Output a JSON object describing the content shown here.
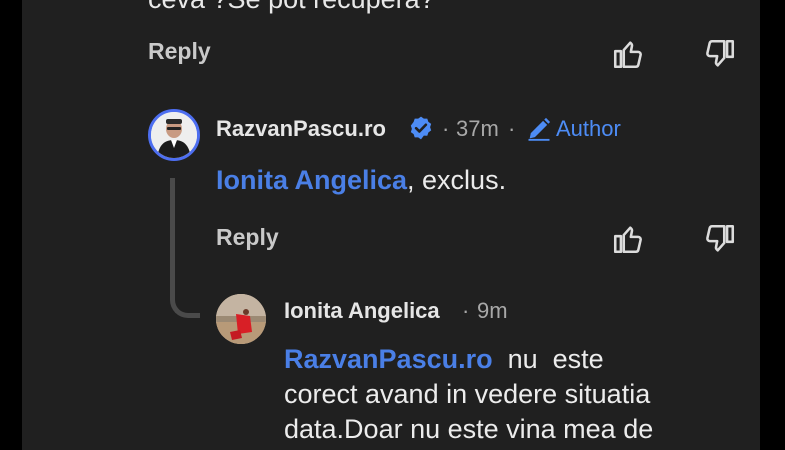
{
  "previous_comment": {
    "text_fragment": "ceva ?Se pot recupera?",
    "reply_label": "Reply"
  },
  "comment_author": {
    "name": "RazvanPascu.ro",
    "time": "37m",
    "separator": "·",
    "author_badge": "Author",
    "mention": "Ionita Angelica",
    "text": ", exclus.",
    "reply_label": "Reply"
  },
  "comment_reply": {
    "name": "Ionita Angelica",
    "time": "9m",
    "separator": "·",
    "mention": "RazvanPascu.ro",
    "lines": [
      "  nu  este",
      "corect avand in vedere situatia",
      "data.Doar nu este vina mea de"
    ]
  },
  "colors": {
    "background": "#202020",
    "link": "#4a7fe6",
    "author_badge": "#4d8cf5",
    "verified": "#4d8cf5"
  },
  "icons": [
    "like-icon",
    "dislike-icon",
    "verified-icon",
    "pencil-icon"
  ]
}
